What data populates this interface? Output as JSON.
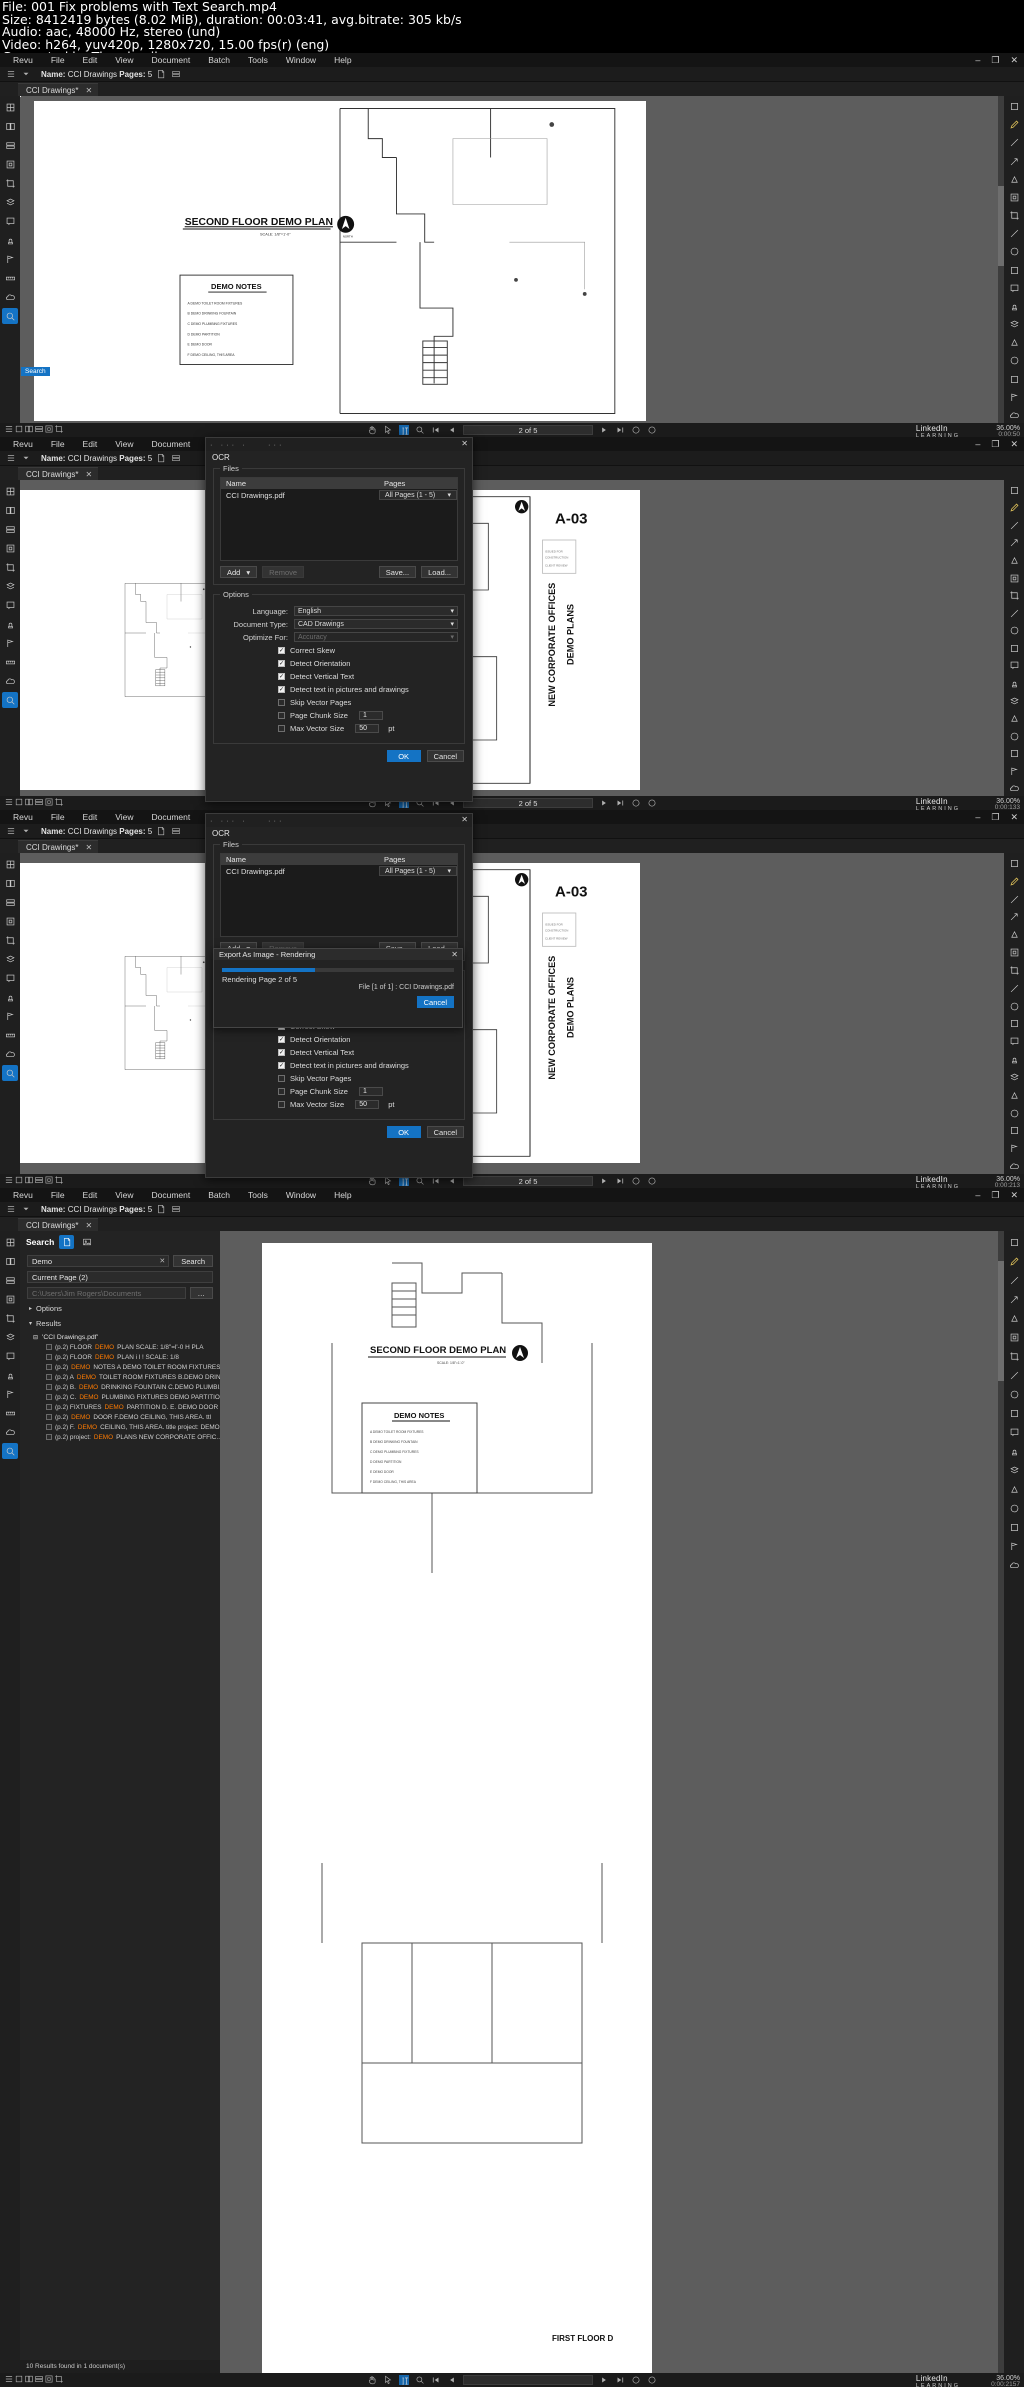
{
  "video_info": {
    "file": "File: 001 Fix problems with Text Search.mp4",
    "size": "Size: 8412419 bytes (8.02 MiB), duration: 00:03:41, avg.bitrate: 305 kb/s",
    "audio": "Audio: aac, 48000 Hz, stereo (und)",
    "video": "Video: h264, yuv420p, 1280x720, 15.00 fps(r) (eng)",
    "generated": "Generated by Thumbnail me"
  },
  "menu": [
    "Revu",
    "File",
    "Edit",
    "View",
    "Document",
    "Batch",
    "Tools",
    "Window",
    "Help"
  ],
  "window_buttons": [
    "minimize",
    "maximize",
    "close"
  ],
  "doc_toolbar": {
    "name_label": "Name:",
    "name_value": "CCI Drawings",
    "pages_label": "Pages:",
    "pages_value": "5"
  },
  "tab": {
    "label": "CCI Drawings*",
    "close": "✕"
  },
  "panels": [
    {
      "id": "panel-1",
      "status": {
        "page": "2 of 5",
        "zoom": "36.00%",
        "time": "0:00:50"
      },
      "drawing": {
        "title": "SECOND FLOOR DEMO PLAN",
        "scale": "SCALE: 1/8\"=1'-0\"",
        "notes_title": "DEMO NOTES",
        "notes": [
          "A   DEMO TOILET ROOM FIXTURES",
          "B   DEMO DRINKING FOUNTAIN",
          "C   DEMO PLUMBING FIXTURES",
          "D   DEMO PARTITION",
          "E   DEMO DOOR",
          "F   DEMO CEILING, THIS AREA"
        ]
      }
    },
    {
      "id": "panel-2",
      "status": {
        "page": "2 of 5",
        "zoom": "36.00%",
        "time": "0:00:133"
      },
      "sheet": {
        "vtitle1": "NEW CORPORATE OFFICES",
        "vtitle2": "DEMO PLANS",
        "number": "A-03"
      }
    },
    {
      "id": "panel-3",
      "status": {
        "page": "2 of 5",
        "zoom": "36.00%",
        "time": "0:00:213"
      },
      "sheet": {
        "vtitle1": "NEW CORPORATE OFFICES",
        "vtitle2": "DEMO PLANS",
        "number": "A-03"
      }
    },
    {
      "id": "panel-4",
      "status": {
        "page": "",
        "zoom": "36.00%",
        "time": "0:00:2157"
      },
      "drawing": {
        "title": "SECOND FLOOR DEMO PLAN",
        "notes_title": "DEMO NOTES",
        "footer": "FIRST FLOOR D"
      }
    }
  ],
  "ocr_dialog": {
    "title": "OCR",
    "close": "✕",
    "files_group": "Files",
    "columns": [
      "Name",
      "Pages"
    ],
    "rows": [
      {
        "name": "CCI Drawings.pdf",
        "pages": "All Pages (1 - 5)"
      }
    ],
    "buttons": {
      "add": "Add",
      "remove": "Remove",
      "save": "Save...",
      "load": "Load..."
    },
    "options_group": "Options",
    "fields": [
      {
        "label": "Language:",
        "value": "English"
      },
      {
        "label": "Document Type:",
        "value": "CAD Drawings"
      },
      {
        "label": "Optimize For:",
        "value": "Accuracy",
        "disabled": true
      }
    ],
    "checkboxes": [
      {
        "label": "Correct Skew",
        "checked": true
      },
      {
        "label": "Detect Orientation",
        "checked": true
      },
      {
        "label": "Detect Vertical Text",
        "checked": true
      },
      {
        "label": "Detect text in pictures and drawings",
        "checked": true
      },
      {
        "label": "Skip Vector Pages",
        "checked": false
      },
      {
        "label": "Page Chunk Size",
        "checked": false,
        "value": "1"
      },
      {
        "label": "Max Vector Size",
        "checked": false,
        "value": "50",
        "unit": "pt"
      }
    ],
    "footer": {
      "ok": "OK",
      "cancel": "Cancel"
    }
  },
  "render_dialog": {
    "title": "Export As Image - Rendering",
    "close": "✕",
    "status": "Rendering Page 2 of 5",
    "file": "File [1 of 1] : CCI Drawings.pdf",
    "cancel": "Cancel",
    "progress_pct": 40
  },
  "search_panel": {
    "title": "Search",
    "icons": [
      "text-search-icon",
      "visual-search-icon"
    ],
    "query": "Demo",
    "clear": "✕",
    "search_button": "Search",
    "scope": "Current Page (2)",
    "path_placeholder": "C:\\Users\\Jim Rogers\\Documents",
    "options_label": "Options",
    "results_label": "Results",
    "result_file": "'CCI Drawings.pdf'",
    "results": [
      {
        "prefix": "(p.2) FLOOR ",
        "hl": "DEMO",
        "suffix": " PLAN SCALE: 1/8\"=l'-0 H PLA"
      },
      {
        "prefix": "(p.2) FLOOR ",
        "hl": "DEMO",
        "suffix": " PLAN i l ! SCALE: 1/8"
      },
      {
        "prefix": "(p.2) ",
        "hl": "DEMO",
        "suffix": " NOTES A DEMO TOILET ROOM FIXTURES ..."
      },
      {
        "prefix": "(p.2) A ",
        "hl": "DEMO",
        "suffix": " TOILET ROOM FIXTURES B.DEMO DRIN..."
      },
      {
        "prefix": "(p.2) B.",
        "hl": "DEMO",
        "suffix": " DRINKING FOUNTAIN C.DEMO PLUMBI..."
      },
      {
        "prefix": "(p.2) C.",
        "hl": "DEMO",
        "suffix": " PLUMBING FIXTURES DEMO PARTITIO..."
      },
      {
        "prefix": "(p.2) FIXTURES ",
        "hl": "DEMO",
        "suffix": " PARTITION D. E. DEMO DOOR F..."
      },
      {
        "prefix": "(p.2) ",
        "hl": "DEMO",
        "suffix": " DOOR F.DEMO CEILING, THIS AREA. ttl"
      },
      {
        "prefix": "(p.2) F.",
        "hl": "DEMO",
        "suffix": " CEILING, THIS AREA. title project: DEMO..."
      },
      {
        "prefix": "(p.2) project: ",
        "hl": "DEMO",
        "suffix": " PLANS NEW CORPORATE OFFIC..."
      }
    ],
    "footer": "10 Results found in 1 document(s)"
  },
  "branding": {
    "name": "LinkedIn",
    "sub": "LEARNING"
  },
  "colors": {
    "accent": "#1473c4",
    "highlight": "#ff7b00",
    "panel_bg": "#232323",
    "canvas": "#5d5d5d"
  }
}
